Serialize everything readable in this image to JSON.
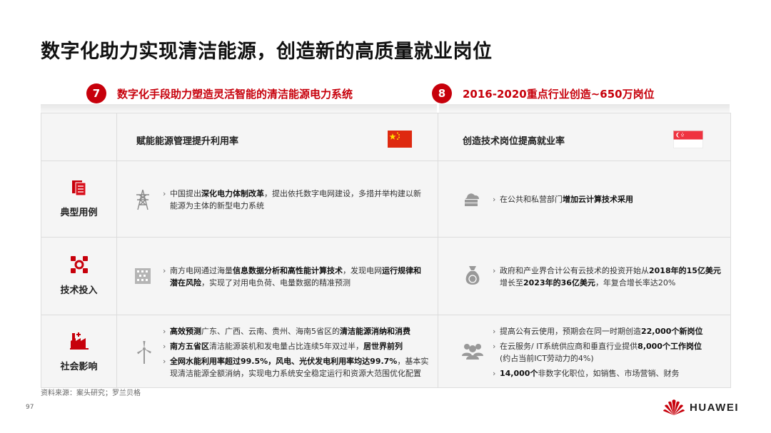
{
  "page": {
    "title": "数字化助力实现清洁能源，创造新的高质量就业岗位",
    "footnote": "资料来源：案头研究；罗兰贝格",
    "page_number": "97",
    "logo_text": "HUAWEI"
  },
  "colors": {
    "accent": "#c7000b",
    "table_bg": "#f5f5f5",
    "line": "#dcdcdc"
  },
  "left_header": {
    "number": "7",
    "text": "数字化手段助力塑造灵活智能的清洁能源电力系统"
  },
  "right_header": {
    "number": "8",
    "text": "2016-2020重点行业创造~650万岗位"
  },
  "columns": {
    "china": {
      "heading": "赋能能源管理提升利用率",
      "flag": "china-flag-icon"
    },
    "singapore": {
      "heading": "创造技术岗位提高就业率",
      "flag": "singapore-flag-icon"
    }
  },
  "rows": [
    {
      "label": "典型用例",
      "icon": "document-stack-icon"
    },
    {
      "label": "技术投入",
      "icon": "gear-network-icon"
    },
    {
      "label": "社会影响",
      "icon": "factory-icon"
    }
  ],
  "china": {
    "r1": {
      "t1": "中国提出",
      "b1": "深化电力体制改革",
      "t2": "，提出依托数字电网建设，多措并举构建以新能源为主体的新型电力系统"
    },
    "r2": {
      "t1": "南方电网通过海量",
      "b1": "信息数据分析和高性能计算技术",
      "t2": "，发现电网",
      "b2": "运行规律和潜在风险",
      "t3": "，实现了对用电负荷、电量数据的精准预测"
    },
    "r3": {
      "l1b1": "高效预测",
      "l1t1": "广东、广西、云南、贵州、海南5省区的",
      "l1b2": "清洁能源消纳和消费",
      "l2b1": "南方五省区",
      "l2t1": "清洁能源装机和发电量占比连续5年双过半，",
      "l2b2": "居世界前列",
      "l3b1": "全网水能利用率超过99.5%，风电、光伏发电利用率均达99.7%",
      "l3t1": "，基本实现清洁能源全额消纳，实现电力系统安全稳定运行和资源大范围优化配置"
    }
  },
  "singapore": {
    "r1": {
      "t1": "在公共和私营部门",
      "b1": "增加云计算技术采用"
    },
    "r2": {
      "t1": "政府和产业界合计公有云技术的投资开始从",
      "b1": "2018年的15亿美元",
      "t2": "增长至",
      "b2": "2023年的36亿美元",
      "t3": "，年复合增长率达20%"
    },
    "r3": {
      "l1t1": "提高公有云使用，预期会在同一时期创造",
      "l1b1": "22,000个新岗位",
      "l2t1": "在云服务/ IT系统供应商和垂直行业提供",
      "l2b1": "8,000个工作岗位",
      "l2t2": "(约占当前ICT劳动力的4%)",
      "l3b1": "14,000个",
      "l3t1": "非数字化职位，如销售、市场营销、财务"
    }
  },
  "cell_icons": [
    "power-tower-icon",
    "cloud-server-icon",
    "data-chip-icon",
    "money-bag-icon",
    "wind-turbine-icon",
    "people-group-icon"
  ]
}
